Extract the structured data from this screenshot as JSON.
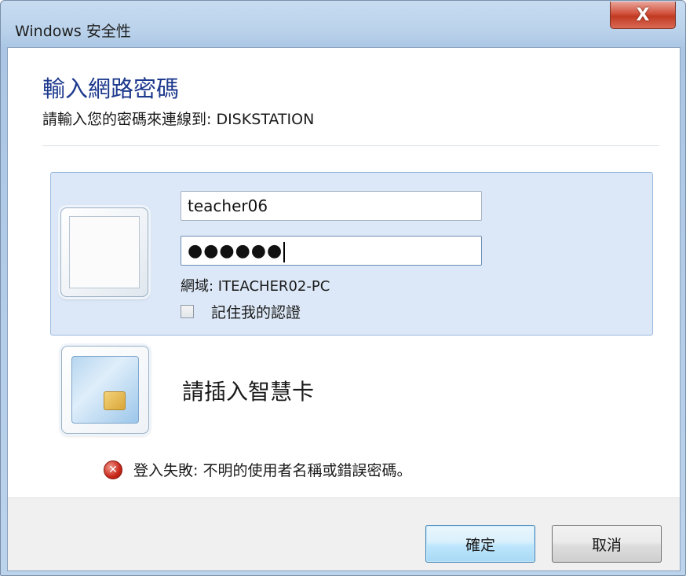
{
  "window": {
    "title": "Windows 安全性",
    "close_glyph": "X"
  },
  "header": {
    "title": "輸入網路密碼",
    "subtitle": "請輸入您的密碼來連線到: DISKSTATION"
  },
  "credentials": {
    "username_value": "teacher06",
    "password_masked": "●●●●●●",
    "domain_label": "網域: ITEACHER02-PC",
    "remember_label": "記住我的認證",
    "remember_checked": false
  },
  "smartcard": {
    "label": "請插入智慧卡",
    "icon": "smartcard-icon"
  },
  "error": {
    "message": "登入失敗: 不明的使用者名稱或錯誤密碼。",
    "icon": "error-icon"
  },
  "buttons": {
    "ok_label": "確定",
    "cancel_label": "取消"
  },
  "colors": {
    "title_accent": "#1e3a8e",
    "panel_bg": "#dce8f7",
    "close_red": "#c13a22"
  }
}
